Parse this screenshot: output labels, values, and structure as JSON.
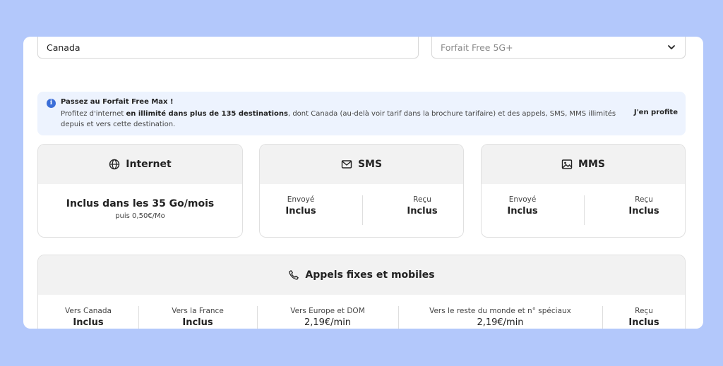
{
  "destination": {
    "value": "Canada"
  },
  "plan": {
    "value": "Forfait Free 5G+",
    "icon": "chevron-down-icon"
  },
  "banner": {
    "icon": "info-icon",
    "title": "Passez au Forfait Free Max !",
    "text_before": "Profitez d'internet ",
    "text_bold": "en illimité dans plus de 135 destinations",
    "text_after": ", dont Canada (au-delà voir tarif dans la brochure tarifaire) et des appels, SMS, MMS illimités depuis et vers cette destination.",
    "cta": "J'en profite"
  },
  "internet": {
    "title": "Internet",
    "icon": "globe-icon",
    "main": "Inclus dans les 35 Go/mois",
    "sub": "puis 0,50€/Mo"
  },
  "sms": {
    "title": "SMS",
    "icon": "envelope-icon",
    "sent_label": "Envoyé",
    "sent_value": "Inclus",
    "received_label": "Reçu",
    "received_value": "Inclus"
  },
  "mms": {
    "title": "MMS",
    "icon": "image-icon",
    "sent_label": "Envoyé",
    "sent_value": "Inclus",
    "received_label": "Reçu",
    "received_value": "Inclus"
  },
  "calls": {
    "title": "Appels fixes et mobiles",
    "icon": "phone-icon",
    "columns": [
      {
        "label": "Vers Canada",
        "value": "Inclus"
      },
      {
        "label": "Vers la France",
        "value": "Inclus"
      },
      {
        "label": "Vers Europe et DOM",
        "value": "2,19€/min"
      },
      {
        "label": "Vers le reste du monde et n° spéciaux",
        "value": "2,19€/min"
      },
      {
        "label": "Reçu",
        "value": "Inclus"
      }
    ]
  }
}
